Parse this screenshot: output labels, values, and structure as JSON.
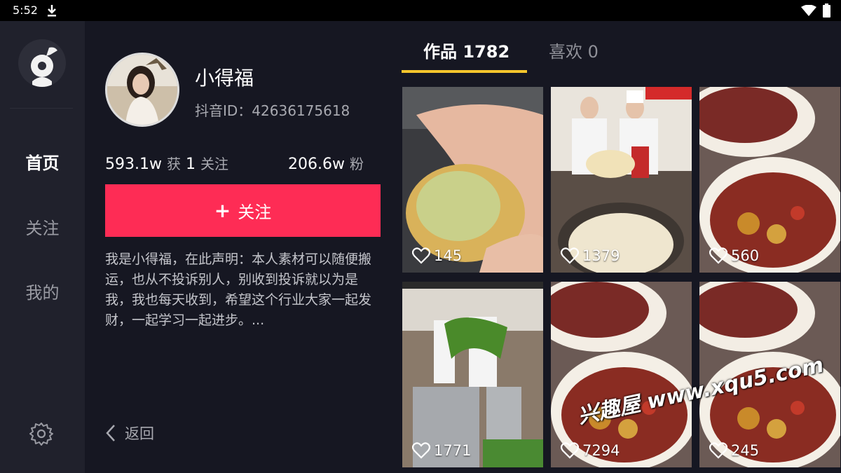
{
  "status_bar": {
    "time": "5:52",
    "icons": [
      "download-icon",
      "wifi-icon",
      "battery-icon"
    ]
  },
  "nav": {
    "items": [
      {
        "label": "首页",
        "active": true
      },
      {
        "label": "关注",
        "active": false
      },
      {
        "label": "我的",
        "active": false
      }
    ]
  },
  "profile": {
    "name": "小得福",
    "douyin_id": "抖音ID：42636175618",
    "likes_value": "593.1w",
    "likes_label": "获",
    "following_value": "1",
    "following_label": "关注",
    "fans_value": "206.6w",
    "fans_label": "粉",
    "follow_button_label": "关注",
    "bio": "我是小得福，在此声明：本人素材可以随便搬运，也从不投诉别人，别收到投诉就以为是我，我也每天收到，希望这个行业大家一起发财，一起学习一起进步。...",
    "back_label": "返回"
  },
  "tabs": [
    {
      "label": "作品 1782",
      "active": true
    },
    {
      "label": "喜欢 0",
      "active": false
    }
  ],
  "videos": [
    {
      "likes": "145"
    },
    {
      "likes": "1379"
    },
    {
      "likes": "560"
    },
    {
      "likes": "1771"
    },
    {
      "likes": "7294"
    },
    {
      "likes": "245"
    }
  ],
  "watermark": "兴趣屋 www.xqu5.com",
  "colors": {
    "accent": "#fe2c55",
    "tab_underline": "#f6c62c",
    "background": "#161722",
    "sidebar": "#20212c"
  }
}
